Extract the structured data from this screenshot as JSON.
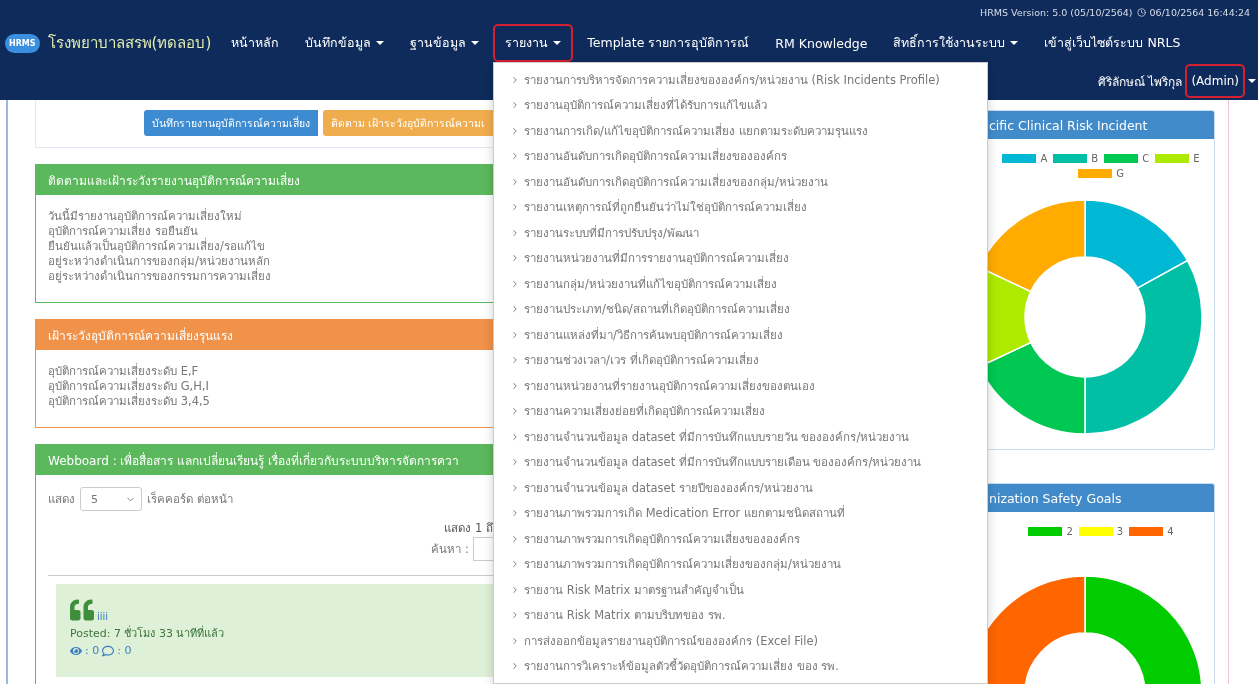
{
  "header": {
    "version": "HRMS Version: 5.0 (05/10/2564)",
    "datetime": "06/10/2564 16:44:24"
  },
  "brand": {
    "logo_text": "HRMS",
    "name": "โรงพยาบาลสรพ(ทดลอบ)"
  },
  "nav": [
    {
      "label": "หน้าหลัก",
      "kind": "link",
      "highlighted": false
    },
    {
      "label": "บันทึกข้อมูล",
      "kind": "dropdown",
      "highlighted": false
    },
    {
      "label": "ฐานข้อมูล",
      "kind": "dropdown",
      "highlighted": false
    },
    {
      "label": "รายงาน",
      "kind": "dropdown",
      "highlighted": true
    },
    {
      "label": "Template รายการอุบัติการณ์",
      "kind": "link",
      "highlighted": false
    },
    {
      "label": "RM Knowledge",
      "kind": "link",
      "highlighted": false
    },
    {
      "label": "สิทธิ์การใช้งานระบบ",
      "kind": "dropdown",
      "highlighted": false
    },
    {
      "label": "เข้าสู่เว็บไซต์ระบบ NRLS",
      "kind": "link",
      "highlighted": false
    }
  ],
  "user": {
    "name": "ศิริลักษณ์ ไพริกุล",
    "role": "(Admin)",
    "highlighted": true
  },
  "actions": [
    {
      "label": "บันทึกรายงานอุบัติการณ์ความเสี่ยง",
      "color": "#3d8bd0"
    },
    {
      "label": "ติดตาม เฝ้าระวังอุบัติการณ์ความเ",
      "color": "#f0ad4e"
    }
  ],
  "panels": [
    {
      "kind": "list",
      "title": "ติดตามและเฝ้าระวังรายงานอุบัติการณ์ความเสี่ยง",
      "color": "#5cb85c",
      "lines": [
        "วันนี้มีรายงานอุบัติการณ์ความเสี่ยงใหม่",
        "อุบัติการณ์ความเสี่ยง รอยืนยัน",
        "ยืนยันแล้วเป็นอุบัติการณ์ความเสี่ยง/รอแก้ไข",
        "อยู่ระหว่างดำเนินการของกลุ่ม/หน่วยงานหลัก",
        "อยู่ระหว่างดำเนินการของกรรมการความเสี่ยง"
      ]
    },
    {
      "kind": "list",
      "title": "เฝ้าระวังอุบัติการณ์ความเสี่ยงรุนแรง",
      "color": "#f0924a",
      "lines": [
        "อุบัติการณ์ความเสี่ยงระดับ E,F",
        "อุบัติการณ์ความเสี่ยงระดับ G,H,I",
        "อุบัติการณ์ความเสี่ยงระดับ 3,4,5"
      ]
    },
    {
      "kind": "webboard",
      "title": "Webboard : เพื่อสื่อสาร แลกเปลี่ยนเรียนรู้ เรื่องที่เกี่ยวกับระบบบริหารจัดการควา",
      "color": "#5cb85c",
      "length_prefix": "แสดง",
      "length_value": "5",
      "length_suffix": "เร็คคอร์ด ต่อหน้า",
      "info": "แสดง 1 ถึ",
      "search_label": "ค้นหา :",
      "post": {
        "title": "iiii",
        "posted": "Posted: 7 ชั่วโมง 33 นาทีที่แล้ว",
        "views": ": 0",
        "comments": ": 0"
      }
    }
  ],
  "report_menu": [
    "รายงานการบริหารจัดการความเสี่ยงขององค์กร/หน่วยงาน (Risk Incidents Profile)",
    "รายงานอุบัติการณ์ความเสี่ยงที่ได้รับการแก้ไขแล้ว",
    "รายงานการเกิด/แก้ไขอุบัติการณ์ความเสี่ยง แยกตามระดับความรุนแรง",
    "รายงานอันดับการเกิดอุบัติการณ์ความเสี่ยงขององค์กร",
    "รายงานอันดับการเกิดอุบัติการณ์ความเสี่ยงของกลุ่ม/หน่วยงาน",
    "รายงานเหตุการณ์ที่ถูกยืนยันว่าไม่ใช่อุบัติการณ์ความเสี่ยง",
    "รายงานระบบที่มีการปรับปรุง/พัฒนา",
    "รายงานหน่วยงานที่มีการรายงานอุบัติการณ์ความเสี่ยง",
    "รายงานกลุ่ม/หน่วยงานที่แก้ไขอุบัติการณ์ความเสี่ยง",
    "รายงานประเภท/ชนิด/สถานที่เกิดอุบัติการณ์ความเสี่ยง",
    "รายงานแหล่งที่มา/วิธีการค้นพบอุบัติการณ์ความเสี่ยง",
    "รายงานช่วงเวลา/เวร ที่เกิดอุบัติการณ์ความเสี่ยง",
    "รายงานหน่วยงานที่รายงานอุบัติการณ์ความเสี่ยงของตนเอง",
    "รายงานความเสี่ยงย่อยที่เกิดอุบัติการณ์ความเสี่ยง",
    "รายงานจำนวนข้อมูล dataset ที่มีการบันทึกแบบรายวัน ขององค์กร/หน่วยงาน",
    "รายงานจำนวนข้อมูล dataset ที่มีการบันทึกแบบรายเดือน ขององค์กร/หน่วยงาน",
    "รายงานจำนวนข้อมูล dataset รายปีขององค์กร/หน่วยงาน",
    "รายงานภาพรวมการเกิด Medication Error แยกตามชนิดสถานที่",
    "รายงานภาพรวมการเกิดอุบัติการณ์ความเสี่ยงขององค์กร",
    "รายงานภาพรวมการเกิดอุบัติการณ์ความเสี่ยงของกลุ่ม/หน่วยงาน",
    "รายงาน Risk Matrix มาตรฐานสำคัญจำเป็น",
    "รายงาน Risk Matrix ตามบริบทของ รพ.",
    "การส่งออกข้อมูลรายงานอุบัติการณ์ขององค์กร (Excel File)",
    "รายงานการวิเคราะห์ข้อมูลตัวชี้วัดอุบัติการณ์ความเสี่ยง ของ รพ."
  ],
  "charts": [
    {
      "title": "cific Clinical Risk Incident",
      "legend": [
        {
          "label": "A",
          "color": "#00b8d4"
        },
        {
          "label": "B",
          "color": "#00bfa5"
        },
        {
          "label": "C",
          "color": "#00c853"
        },
        {
          "label": "E",
          "color": "#aeea00"
        },
        {
          "label": "G",
          "color": "#ffab00"
        }
      ]
    },
    {
      "title": "nization Safety Goals",
      "legend": [
        {
          "label": "2",
          "color": "#00cc00"
        },
        {
          "label": "3",
          "color": "#ffff00"
        },
        {
          "label": "4",
          "color": "#ff6600"
        }
      ]
    }
  ]
}
